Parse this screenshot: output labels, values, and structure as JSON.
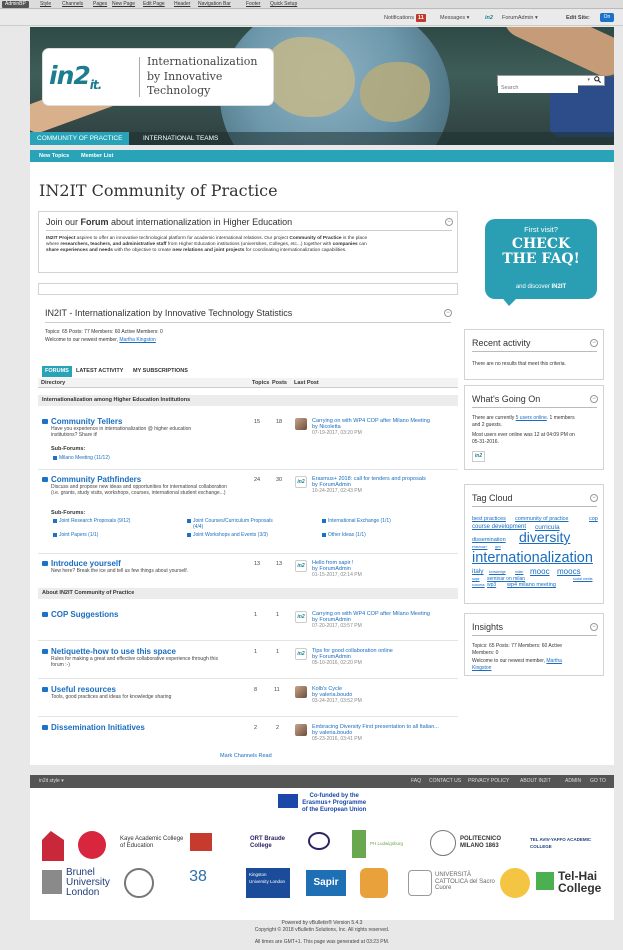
{
  "admin_bar": {
    "button": "AdminBP",
    "links": [
      "Style",
      "Channels",
      "Pages",
      "New Page",
      "Edit Page",
      "Header",
      "Navigation Bar",
      "Footer",
      "Quick Setup"
    ]
  },
  "user_bar": {
    "notifications": "Notifications",
    "notifications_count": "11",
    "messages": "Messages",
    "user": "ForumAdmin",
    "edit_site": "Edit Site:",
    "edit_site_toggle": "On"
  },
  "header": {
    "logo_mark": "in2",
    "logo_sub": "it.",
    "logo_text": [
      "Internationalization",
      "by Innovative",
      "Technology"
    ],
    "search_placeholder": "Search"
  },
  "nav": {
    "tabs": [
      {
        "label": "COMMUNITY OF PRACTICE",
        "active": true
      },
      {
        "label": "INTERNATIONAL TEAMS",
        "active": false
      }
    ],
    "subnav": [
      "New Topics",
      "Member List"
    ]
  },
  "page": {
    "title": "IN2IT Community of Practice",
    "forum_intro": {
      "title_pre": "Join our ",
      "title_link": "Forum",
      "title_post": " about internationalization in Higher Education",
      "body_l1_b1": "IN2IT Project",
      "body_l1": " aspires to offer an innovative technological platform for academic international relations. Our project ",
      "body_l1_b2": "Community of Practice",
      "body_l1_end": " is the place",
      "body_l2_pre": "where ",
      "body_l2_b": "researchers, teachers, and administrative staff",
      "body_l2": " from Higher Education institutions (universities, Colleges, etc...) together with ",
      "body_l2_b2": "companies",
      "body_l2_end": " can",
      "body_l3_b": "share experiences and needs",
      "body_l3": " with the objective to create ",
      "body_l3_b2": "new relations and joint projects",
      "body_l3_end": " for coordinating internationalization capabilities."
    },
    "stats": {
      "title": "IN2IT - Internationalization by Innovative Technology Statistics",
      "line1": "Topics: 65   Posts: 77   Members: 60   Active Members: 0",
      "line2_pre": "Welcome to our newest member, ",
      "line2_link": "Martha Kingston"
    },
    "forum_tabs": [
      "FORUMS",
      "LATEST ACTIVITY",
      "MY SUBSCRIPTIONS"
    ],
    "table_headers": [
      "Directory",
      "Topics",
      "Posts",
      "Last Post"
    ],
    "section1": "Internationalization among Higher Education Institutions",
    "forums1": [
      {
        "title": "Community Tellers",
        "desc": "Have you experience in internationalization @ higher education institutions? Share it!",
        "topics": "15",
        "posts": "18",
        "lp_title": "Carrying on with WP4 COP after Milano Meeting",
        "lp_by": "by Nicoletta",
        "lp_date": "07-19-2017, 03:20 PM",
        "sub_h": "Sub-Forums:",
        "subs": [
          "Milano Meeting (11/12)"
        ]
      },
      {
        "title": "Community Pathfinders",
        "desc": "Discuss and propose new ideas and opportunities for international collaboration (i.e. grants, study visits, workshops, courses, international student exchange...)",
        "topics": "24",
        "posts": "30",
        "lp_title": "Erasmus+ 2018: call for tenders and proposals",
        "lp_by": "by ForumAdmin",
        "lp_date": "10-24-2017, 02:43 PM",
        "sub_h": "Sub-Forums:",
        "subs": [
          "Joint Research Proposals (9/12)",
          "Joint Courses/Curriculum Proposals (4/4)",
          "International Exchange (1/1)",
          "Joint Papers (1/1)",
          "Joint Workshops and Events (3/3)",
          "Other Ideas (1/1)"
        ]
      },
      {
        "title": "Introduce yourself",
        "desc": "New here? Break the ice and tell us few things about yourself.",
        "topics": "13",
        "posts": "13",
        "lp_title": "Hello from sapir !",
        "lp_by": "by ForumAdmin",
        "lp_date": "01-15-2017, 02:14 PM"
      }
    ],
    "section2": "About IN2IT Community of Practice",
    "forums2": [
      {
        "title": "COP Suggestions",
        "desc": "",
        "topics": "1",
        "posts": "1",
        "lp_title": "Carrying on with WP4 COP after Milano Meeting",
        "lp_by": "by ForumAdmin",
        "lp_date": "07-20-2017, 03:57 PM"
      },
      {
        "title": "Netiquette-how to use this space",
        "desc": "Rules for making a great and effective collaborative experience through this forum :-)",
        "topics": "1",
        "posts": "1",
        "lp_title": "Tips for good collaboration online",
        "lp_by": "by ForumAdmin",
        "lp_date": "05-10-2016, 02:20 PM"
      },
      {
        "title": "Useful resources",
        "desc": "Tools, good practices and ideas for knowledge sharing",
        "topics": "8",
        "posts": "11",
        "lp_title": "Kolb's Cycle",
        "lp_by": "by valeria.boudo",
        "lp_date": "03-24-2017, 03:52 PM"
      },
      {
        "title": "Dissemination Initiatives",
        "desc": "",
        "topics": "2",
        "posts": "2",
        "lp_title": "Embracing Diversity First presentation to all Italian...",
        "lp_by": "by valeria.boudo",
        "lp_date": "05-23-2016, 03:41 PM"
      }
    ],
    "mark_read": "Mark Channels Read"
  },
  "sidebar": {
    "faq": {
      "l1": "First visit?",
      "l2": "CHECK",
      "l3": "THE FAQ!",
      "l4_pre": "and discover ",
      "l4_b": "IN2IT"
    },
    "recent": {
      "title": "Recent activity",
      "body": "There are no results that meet this criteria."
    },
    "going_on": {
      "title": "What's Going On",
      "l1_pre": "There are currently ",
      "l1_link": "5 users online",
      "l1_post": ". 1 members",
      "l2": "and 2 guests.",
      "l3": "Most users ever online was 12 at 04:09 PM on",
      "l4": "05-31-2016."
    },
    "tag_cloud": {
      "title": "Tag Cloud",
      "tags": [
        "best practices",
        "community of practice",
        "cop",
        "course development",
        "curricula",
        "dissemination",
        "diversity",
        "erasmus+",
        "gen",
        "internationalization",
        "italy",
        "knowledge",
        "milan",
        "mooc",
        "moocs",
        "sapir",
        "seminar on milan",
        "social media",
        "success",
        "wp3",
        "wp4 milano meeting"
      ]
    },
    "insights": {
      "title": "Insights",
      "l1": "Topics: 65   Posts: 77   Members: 60   Active",
      "l2": "Members: 0",
      "l3_pre": "Welcome to our newest member, ",
      "l3_link": "Martha",
      "l4_link": "Kingston"
    }
  },
  "footer": {
    "style": "in2it style",
    "links": [
      "FAQ",
      "CONTACT US",
      "PRIVACY POLICY",
      "ABOUT IN2IT",
      "ADMIN",
      "GO TO TOP"
    ],
    "eu": [
      "Co-funded by the",
      "Erasmus+ Programme",
      "of the European Union"
    ],
    "partners": [
      "Kaye Academic College of Education",
      "ORT Braude College",
      "PH Ludwigsburg",
      "POLITECNICO MILANO 1863",
      "TEL AVIV-YAFFO ACADEMIC COLLEGE",
      "Brunel University London",
      "Kingston University London",
      "Sapir",
      "UNIVERSITÀ CATTOLICA del Sacro Cuore",
      "Tel-Hai College"
    ],
    "credits": [
      "Powered by vBulletin® Version 5.4.3",
      "Copyright © 2018 vBulletin Solutions, Inc. All rights reserved.",
      "All times are GMT+1. This page was generated at 03:23 PM."
    ]
  },
  "colors": {
    "accent": "#29a3b7",
    "link": "#1a6dc0",
    "brand": "#1c7d8f"
  }
}
